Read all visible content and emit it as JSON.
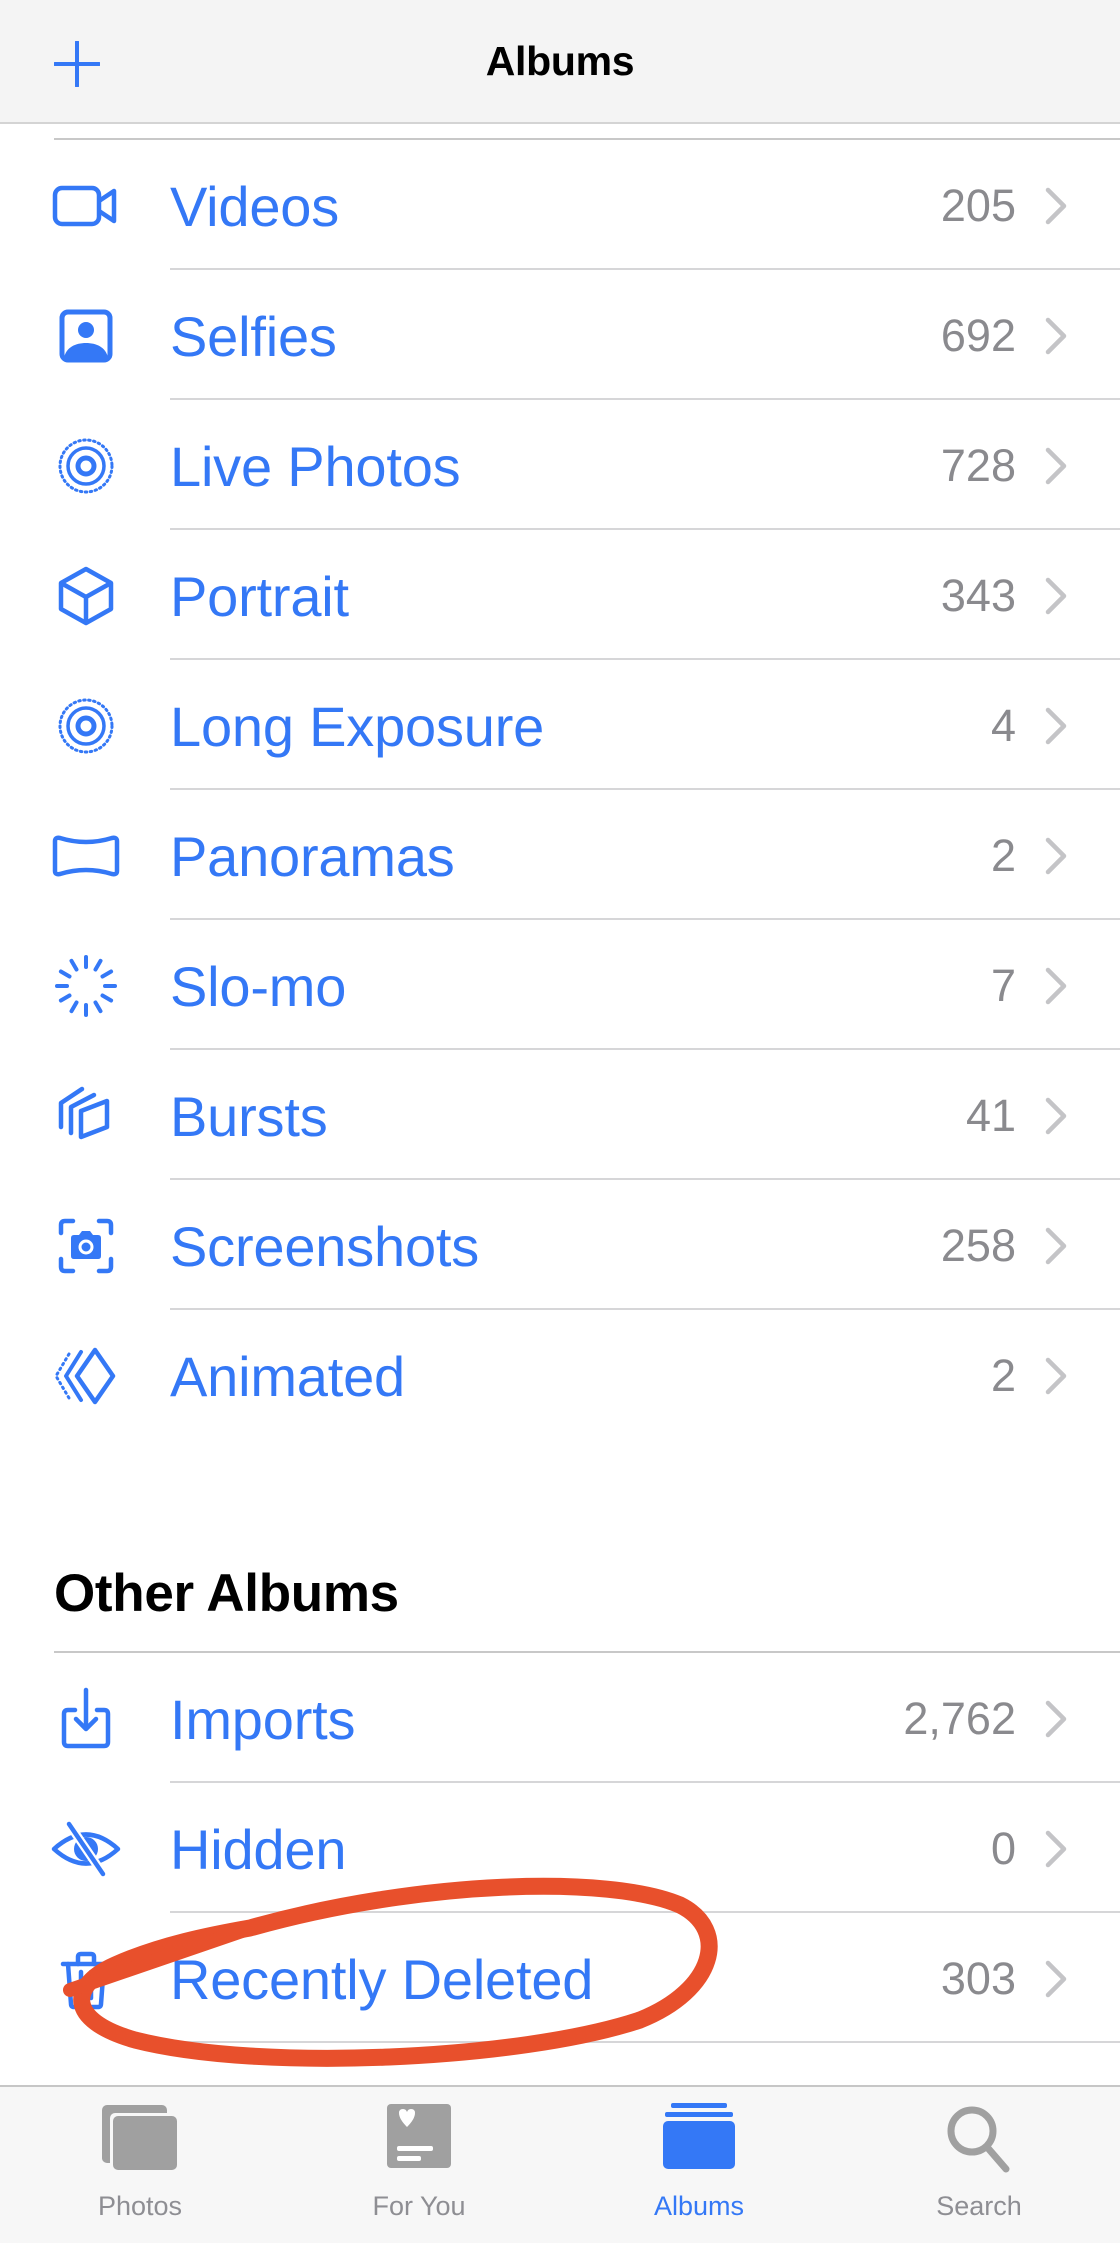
{
  "header": {
    "title": "Albums",
    "add_icon": "plus-icon"
  },
  "colors": {
    "accent": "#3478f6",
    "count_gray": "#8a8a8e",
    "annotation_red": "#e8502c",
    "tab_inactive": "#8e8e93"
  },
  "media_types": [
    {
      "label": "Videos",
      "count": "205",
      "icon": "video-camera-icon"
    },
    {
      "label": "Selfies",
      "count": "692",
      "icon": "person-portrait-icon"
    },
    {
      "label": "Live Photos",
      "count": "728",
      "icon": "live-photo-icon"
    },
    {
      "label": "Portrait",
      "count": "343",
      "icon": "cube-icon"
    },
    {
      "label": "Long Exposure",
      "count": "4",
      "icon": "long-exposure-icon"
    },
    {
      "label": "Panoramas",
      "count": "2",
      "icon": "panorama-icon"
    },
    {
      "label": "Slo-mo",
      "count": "7",
      "icon": "slo-mo-icon"
    },
    {
      "label": "Bursts",
      "count": "41",
      "icon": "bursts-icon"
    },
    {
      "label": "Screenshots",
      "count": "258",
      "icon": "screenshot-icon"
    },
    {
      "label": "Animated",
      "count": "2",
      "icon": "animated-icon"
    }
  ],
  "other_albums": {
    "title": "Other Albums",
    "items": [
      {
        "label": "Imports",
        "count": "2,762",
        "icon": "import-icon"
      },
      {
        "label": "Hidden",
        "count": "0",
        "icon": "eye-slash-icon"
      },
      {
        "label": "Recently Deleted",
        "count": "303",
        "icon": "trash-icon",
        "highlighted": true
      }
    ]
  },
  "annotation": {
    "type": "hand-drawn-ellipse",
    "target": "Recently Deleted"
  },
  "tabbar": {
    "tabs": [
      {
        "label": "Photos",
        "icon": "photos-stack-icon",
        "active": false
      },
      {
        "label": "For You",
        "icon": "for-you-card-icon",
        "active": false
      },
      {
        "label": "Albums",
        "icon": "albums-icon",
        "active": true
      },
      {
        "label": "Search",
        "icon": "search-icon",
        "active": false
      }
    ]
  }
}
